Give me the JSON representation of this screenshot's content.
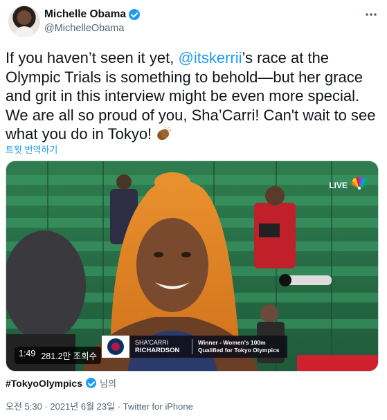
{
  "author": {
    "display_name": "Michelle Obama",
    "handle": "@MichelleObama",
    "verified": true
  },
  "tweet": {
    "text_before_mention": "If you haven’t seen it yet, ",
    "mention": "@itskerrii",
    "text_after_mention": "’s race at the Olympic Trials is something to behold—but her grace and grit in this interview might be even more special. We are all so proud of you, Sha’Carri! Can't wait to see what you do in Tokyo! ",
    "emoji_icon": "clapping-hands-icon",
    "translate_label": "트윗 번역하기"
  },
  "video": {
    "live_label": "LIVE",
    "duration": "1:49",
    "views": "281.2만 조회수",
    "lower_third": {
      "first_name": "SHA'CARRI",
      "last_name": "RICHARDSON",
      "line1": "Winner - Women's 100m",
      "line2": "Qualified for Tokyo Olympics"
    }
  },
  "attribution": {
    "hashtag": "#TokyoOlympics",
    "suffix": "님의"
  },
  "meta": {
    "timestamp": "오전 5:30 · 2021년 6월 23일 · Twitter for iPhone"
  },
  "colors": {
    "accent": "#1d9bf0",
    "text_primary": "#0f1419",
    "text_secondary": "#536471"
  }
}
